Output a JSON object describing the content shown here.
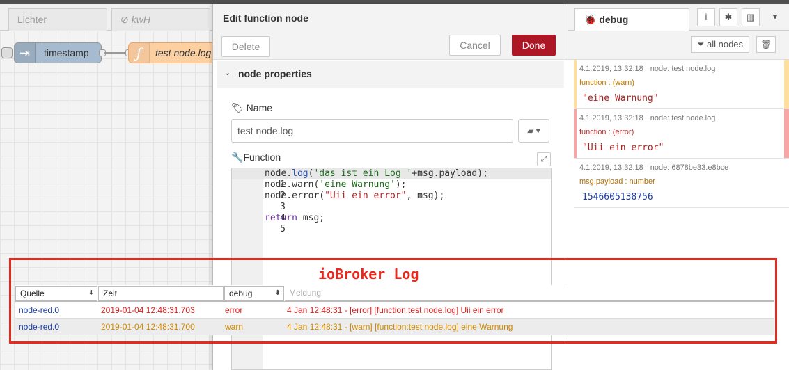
{
  "workspace": {
    "tabs": [
      {
        "label": "Lichter"
      },
      {
        "label": "kwH",
        "icon": "disabled-icon"
      }
    ],
    "nodes": [
      {
        "label": "timestamp",
        "type": "inject",
        "color": "#a6bbcf"
      },
      {
        "label": "test node.log",
        "type": "function",
        "color": "#fdd0a2"
      }
    ]
  },
  "edit_tray": {
    "title": "Edit function node",
    "delete_label": "Delete",
    "cancel_label": "Cancel",
    "done_label": "Done",
    "section_title": "node properties",
    "name_label": "Name",
    "name_value": "test node.log",
    "function_label": "Function",
    "code_lines": [
      {
        "n": "1",
        "text": "node.log('das ist ein Log '+msg.payload);"
      },
      {
        "n": "2",
        "text": "node.warn('eine Warnung');"
      },
      {
        "n": "3",
        "text": "node.error(\"Uii ein error\", msg);"
      },
      {
        "n": "4",
        "text": ""
      },
      {
        "n": "5",
        "text": "return msg;"
      }
    ]
  },
  "sidebar": {
    "tab_label": "debug",
    "filter_label": "all nodes",
    "messages": [
      {
        "meta": "4.1.2019, 13:32:18",
        "node": "node: test node.log",
        "sub": "function : (warn)",
        "value": "\"eine Warnung\"",
        "level": "warn",
        "bar_color": "#ffdf9d",
        "sub_color": "#c07a00",
        "value_color": "#a22"
      },
      {
        "meta": "4.1.2019, 13:32:18",
        "node": "node: test node.log",
        "sub": "function : (error)",
        "value": "\"Uii ein error\"",
        "level": "error",
        "bar_color": "#f8a5a5",
        "sub_color": "#c03030",
        "value_color": "#a22"
      },
      {
        "meta": "4.1.2019, 13:32:18",
        "node": "node: 6878be33.e8bce",
        "sub": "msg.payload : number",
        "value": "1546605138756",
        "level": "info",
        "bar_color": "",
        "sub_color": "#b07010",
        "value_color": "#1f3fa8"
      }
    ]
  },
  "iobroker_log": {
    "title": "ioBroker Log",
    "columns": {
      "quelle": "Quelle",
      "zeit": "Zeit",
      "level": "debug",
      "meldung": "Meldung"
    },
    "rows": [
      {
        "quelle": "node-red.0",
        "zeit": "2019-01-04 12:48:31.703",
        "level": "error",
        "meldung": "4 Jan 12:48:31 - [error] [function:test node.log] Uii ein error"
      },
      {
        "quelle": "node-red.0",
        "zeit": "2019-01-04 12:48:31.700",
        "level": "warn",
        "meldung": "4 Jan 12:48:31 - [warn] [function:test node.log] eine Warnung"
      }
    ]
  },
  "colors": {
    "done_button": "#ad1625",
    "highlight_box": "#e8291c",
    "error_text": "#e02020",
    "warn_text": "#d08a00"
  }
}
